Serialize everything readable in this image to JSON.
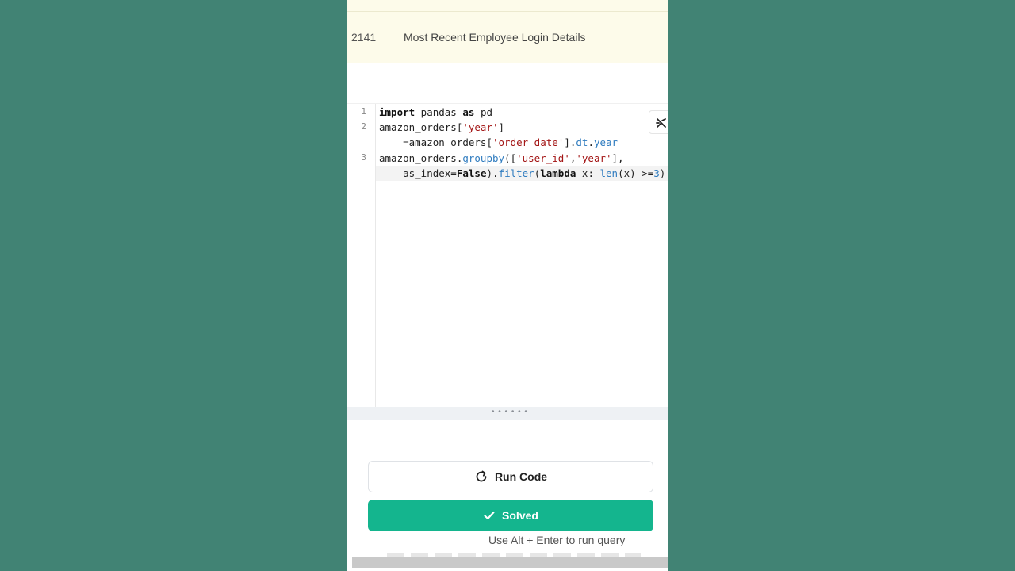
{
  "question": {
    "id": "2141",
    "title": "Most Recent Employee Login Details"
  },
  "editor": {
    "line_numbers": [
      "1",
      "2",
      "3"
    ],
    "format_icon": "no-format-icon"
  },
  "resize_handle": "• • • • • •",
  "buttons": {
    "run_label": "Run Code",
    "run_icon": "refresh-icon",
    "solved_label": "Solved",
    "solved_icon": "check-icon"
  },
  "hint": "Use Alt + Enter to run query",
  "colors": {
    "page_background": "#418374",
    "question_band": "#fdfbea",
    "solved_button": "#14b58e"
  }
}
